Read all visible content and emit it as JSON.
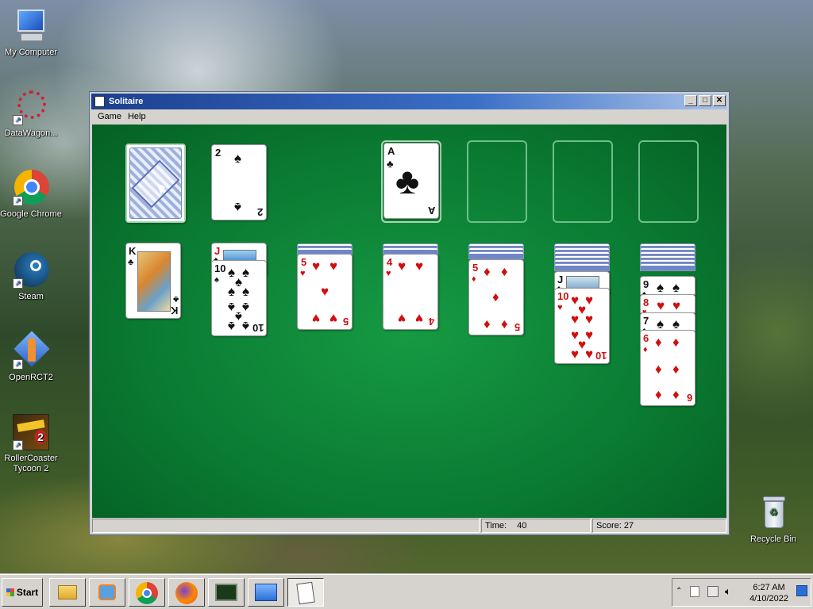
{
  "desktop": {
    "icons": [
      {
        "label": "My Computer",
        "icon": "computer-icon"
      },
      {
        "label": "DataWagon...",
        "icon": "datawagon-icon"
      },
      {
        "label": "Google Chrome",
        "icon": "chrome-icon"
      },
      {
        "label": "Steam",
        "icon": "steam-icon"
      },
      {
        "label": "OpenRCT2",
        "icon": "openrct2-icon"
      },
      {
        "label": "RollerCoaster Tycoon 2",
        "icon": "rct2-icon"
      },
      {
        "label": "Recycle Bin",
        "icon": "recycle-bin-icon"
      }
    ]
  },
  "window": {
    "title": "Solitaire",
    "menu": [
      "Game",
      "Help"
    ],
    "status": {
      "time_label": "Time:",
      "time": "40",
      "score_label": "Score:",
      "score": "27"
    }
  },
  "cards": {
    "waste": {
      "rank": "2",
      "suit": "♠"
    },
    "foundation": {
      "rank": "A",
      "suit": "♣"
    },
    "t1": {
      "rank": "K",
      "suit": "♣"
    },
    "t2_top": {
      "rank": "J",
      "suit": "♠"
    },
    "t2": {
      "rank": "10",
      "suit": "♠"
    },
    "t3": {
      "rank": "5",
      "suit": "♥"
    },
    "t4": {
      "rank": "4",
      "suit": "♥"
    },
    "t5": {
      "rank": "5",
      "suit": "♦"
    },
    "t6_top": {
      "rank": "J",
      "suit": "♠"
    },
    "t6": {
      "rank": "10",
      "suit": "♥"
    },
    "t7a": {
      "rank": "9",
      "suit": "♠"
    },
    "t7b": {
      "rank": "8",
      "suit": "♥"
    },
    "t7c": {
      "rank": "7",
      "suit": "♠"
    },
    "t7": {
      "rank": "6",
      "suit": "♦"
    }
  },
  "taskbar": {
    "start": "Start",
    "time": "6:27 AM",
    "date": "4/10/2022"
  },
  "colors": {
    "felt": "#0a7a32",
    "titlebar": "#1c3f8f",
    "red_suit": "#d10f0f"
  }
}
